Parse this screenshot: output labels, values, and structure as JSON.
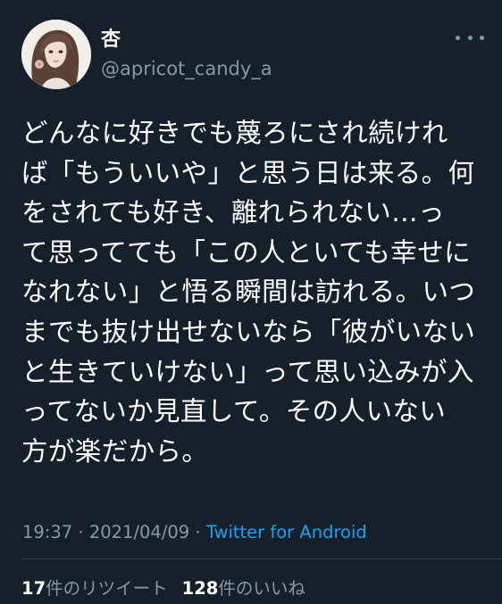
{
  "author": {
    "display_name": "杏",
    "handle": "@apricot_candy_a",
    "avatar_icon": "avatar-illustration"
  },
  "tweet": {
    "text": "どんなに好きでも蔑ろにされ続ければ「もういいや」と思う日は来る。何をされても好き、離れられない…って思ってても「この人といても幸せになれない」と悟る瞬間は訪れる。いつまでも抜け出せないなら「彼がいないと生きていけない」って思い込みが入ってないか見直して。その人いない方が楽だから。",
    "lines": [
      "どんなに好きでも蔑ろにされ続けれ",
      "ば「もういいや」と思う日は来る。何",
      "をされても好き、離れられない…っ",
      "て思ってても「この人といても幸せに",
      "なれない」と悟る瞬間は訪れる。いつ",
      "までも抜け出せないなら「彼がいない",
      "と生きていけない」って思い込みが入",
      "ってないか見直して。その人いない",
      "方が楽だから。"
    ]
  },
  "meta": {
    "time": "19:37",
    "separator": "·",
    "date": "2021/04/09",
    "source": "Twitter for Android"
  },
  "stats": {
    "retweets_count": "17",
    "retweets_label": "件のリツイート",
    "likes_count": "128",
    "likes_label": "件のいいね"
  },
  "colors": {
    "background": "#15202b",
    "secondary_text": "#8899a6",
    "link": "#1da1f2",
    "divider": "#38444d"
  },
  "icons": {
    "more": "more-horizontal-icon"
  }
}
